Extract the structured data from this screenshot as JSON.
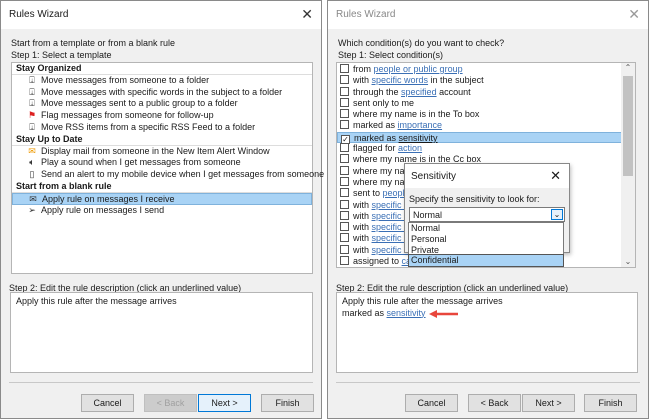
{
  "left": {
    "title": "Rules Wizard",
    "intro": "Start from a template or from a blank rule",
    "step1": "Step 1: Select a template",
    "groups": [
      {
        "name": "Stay Organized",
        "items": [
          {
            "icon": "move-to-folder-icon",
            "label": "Move messages from someone to a folder"
          },
          {
            "icon": "move-to-folder-icon",
            "label": "Move messages with specific words in the subject to a folder"
          },
          {
            "icon": "move-to-folder-icon",
            "label": "Move messages sent to a public group to a folder"
          },
          {
            "icon": "flag-icon",
            "label": "Flag messages from someone for follow-up"
          },
          {
            "icon": "move-to-folder-icon",
            "label": "Move RSS items from a specific RSS Feed to a folder"
          }
        ]
      },
      {
        "name": "Stay Up to Date",
        "items": [
          {
            "icon": "alert-mail-icon",
            "label": "Display mail from someone in the New Item Alert Window"
          },
          {
            "icon": "speaker-icon",
            "label": "Play a sound when I get messages from someone"
          },
          {
            "icon": "mobile-icon",
            "label": "Send an alert to my mobile device when I get messages from someone"
          }
        ]
      },
      {
        "name": "Start from a blank rule",
        "items": [
          {
            "icon": "envelope-icon",
            "label": "Apply rule on messages I receive",
            "selected": true
          },
          {
            "icon": "send-icon",
            "label": "Apply rule on messages I send"
          }
        ]
      }
    ],
    "step2": "Step 2: Edit the rule description (click an underlined value)",
    "description": [
      "Apply this rule after the message arrives"
    ],
    "buttons": {
      "cancel": "Cancel",
      "back": "< Back",
      "next": "Next >",
      "finish": "Finish"
    }
  },
  "right": {
    "title": "Rules Wizard",
    "intro": "Which condition(s) do you want to check?",
    "step1": "Step 1: Select condition(s)",
    "conditions": [
      {
        "pre": "from ",
        "link": "people or public group",
        "post": ""
      },
      {
        "pre": "with ",
        "link": "specific words",
        "post": " in the subject"
      },
      {
        "pre": "through the ",
        "link": "specified",
        "post": " account"
      },
      {
        "pre": "sent only to me",
        "link": "",
        "post": ""
      },
      {
        "pre": "where my name is in the To box",
        "link": "",
        "post": ""
      },
      {
        "pre": "marked as ",
        "link": "importance",
        "post": ""
      },
      {
        "pre": "marked as ",
        "link": "sensitivity",
        "post": "",
        "checked": true,
        "selected": true
      },
      {
        "pre": "flagged for ",
        "link": "action",
        "post": ""
      },
      {
        "pre": "where my name is in the Cc box",
        "link": "",
        "post": ""
      },
      {
        "pre": "where my name",
        "link": "",
        "post": ""
      },
      {
        "pre": "where my name",
        "link": "",
        "post": ""
      },
      {
        "pre": "sent to ",
        "link": "people",
        "post": ""
      },
      {
        "pre": "with ",
        "link": "specific wo",
        "post": ""
      },
      {
        "pre": "with ",
        "link": "specific wo",
        "post": ""
      },
      {
        "pre": "with ",
        "link": "specific wo",
        "post": ""
      },
      {
        "pre": "with ",
        "link": "specific wo",
        "post": ""
      },
      {
        "pre": "with ",
        "link": "specific wo",
        "post": ""
      },
      {
        "pre": "assigned to ",
        "link": "cate",
        "post": ""
      }
    ],
    "step2": "Step 2: Edit the rule description (click an underlined value)",
    "description_line1": "Apply this rule after the message arrives",
    "description_line2_pre": "marked as ",
    "description_line2_link": "sensitivity",
    "buttons": {
      "cancel": "Cancel",
      "back": "< Back",
      "next": "Next >",
      "finish": "Finish"
    }
  },
  "popup": {
    "title": "Sensitivity",
    "label": "Specify the sensitivity to look for:",
    "value": "Normal",
    "options": [
      "Normal",
      "Personal",
      "Private",
      "Confidential"
    ],
    "highlighted": "Confidential"
  },
  "colors": {
    "selection": "#a9d3f5",
    "link": "#3a6fb5",
    "arrow": "#e8463c"
  }
}
